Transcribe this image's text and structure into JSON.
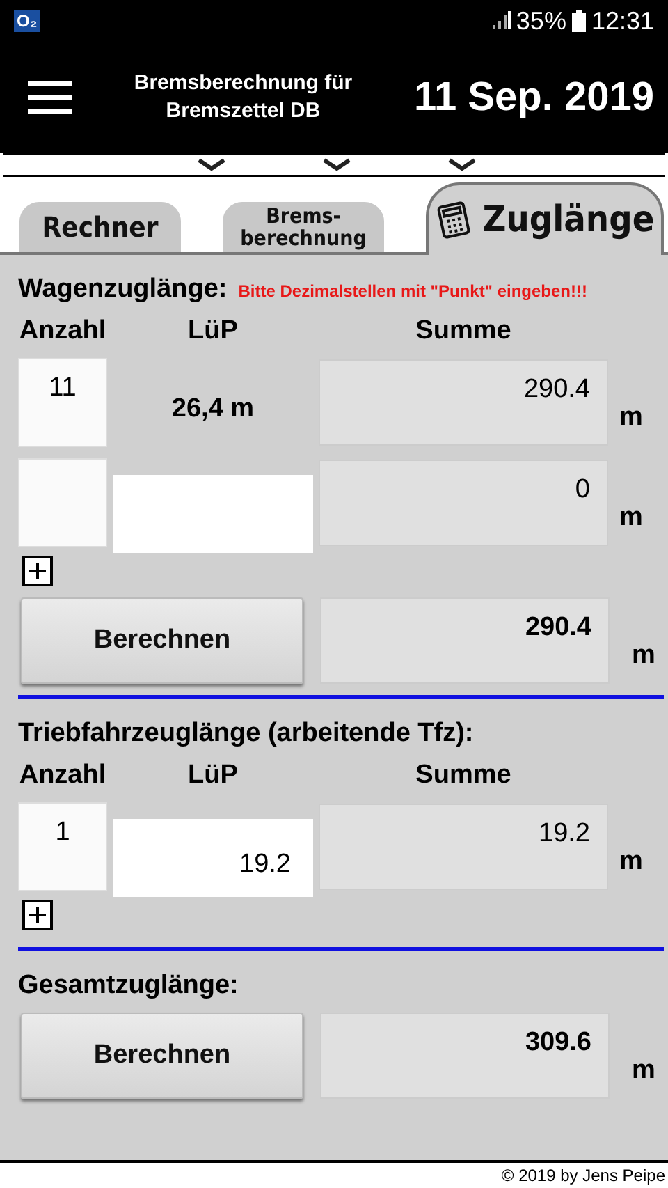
{
  "status_bar": {
    "carrier": "O₂",
    "battery": "35%",
    "time": "12:31"
  },
  "header": {
    "title_lines": [
      "Bremsberechnung für",
      "Bremszettel DB"
    ],
    "date": "11 Sep. 2019"
  },
  "tabs": [
    {
      "label": "Rechner",
      "selected": false
    },
    {
      "label": "Brems-\nberechnung",
      "selected": false
    },
    {
      "label": "Zuglänge",
      "selected": true,
      "kind": "icon"
    }
  ],
  "sections": [
    {
      "kind": "rows",
      "title": "Wagenzuglänge:",
      "hint": "Bitte Dezimalstellen mit \"Punkt\" eingeben!!!",
      "columns": [
        "Anzahl",
        "LüP",
        "Summe"
      ],
      "rows": [
        {
          "count": "11",
          "kind": "fixed",
          "lup": "26,4 m",
          "sum": "290.4",
          "unit": "m"
        },
        {
          "kind": "entry",
          "sum": "0",
          "unit": "m"
        }
      ],
      "add": true,
      "total": {
        "button": "Berechnen",
        "value": "290.4",
        "unit": "m"
      }
    },
    {
      "kind": "rows",
      "title": "Triebfahrzeuglänge (arbeitende Tfz):",
      "columns": [
        "Anzahl",
        "LüP",
        "Summe"
      ],
      "rows": [
        {
          "count": "1",
          "kind": "entry",
          "lup": "19.2",
          "sum": "19.2",
          "unit": "m"
        }
      ],
      "add": true
    },
    {
      "kind": "total",
      "title": "Gesamtzuglänge:",
      "total": {
        "button": "Berechnen",
        "value": "309.6",
        "unit": "m"
      }
    }
  ],
  "footer": "© 2019 by Jens Peipe"
}
